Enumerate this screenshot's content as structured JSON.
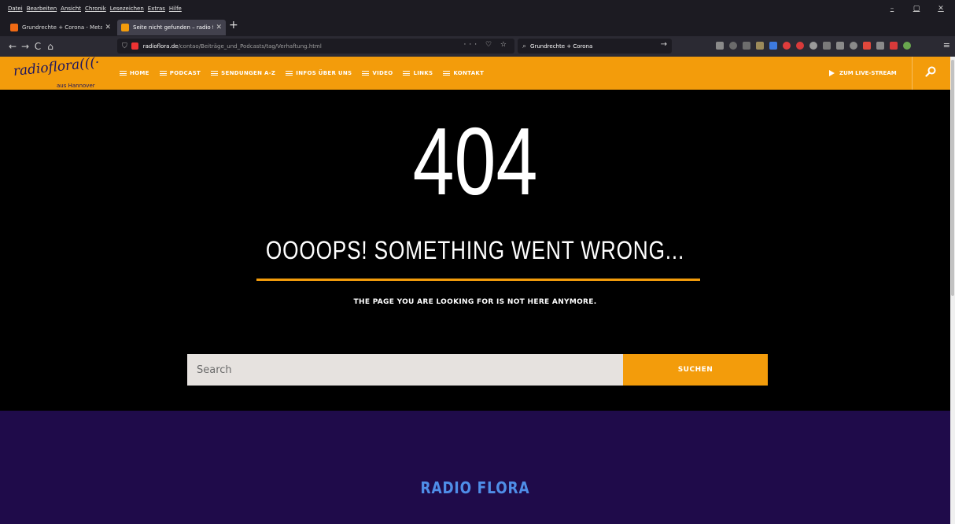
{
  "browser": {
    "menu": [
      "Datei",
      "Bearbeiten",
      "Ansicht",
      "Chronik",
      "Lesezeichen",
      "Extras",
      "Hilfe"
    ],
    "window_controls": [
      "–",
      "▢",
      "✕"
    ],
    "tabs": [
      {
        "title": "Grundrechte + Corona - MetaGer",
        "close": "✕"
      },
      {
        "title": "Seite nicht gefunden – radio flora",
        "close": "✕"
      }
    ],
    "new_tab": "+",
    "nav": {
      "back": "←",
      "forward": "→",
      "reload": "C",
      "home": "⌂"
    },
    "url_host": "radioflora.de",
    "url_path": "/contao/Beiträge_und_Podcasts/tag/Verhaftung.html",
    "url_actions": "··· ♡ ☆",
    "search_query": "Grundrechte + Corona",
    "menu_icon": "≡"
  },
  "site": {
    "logo_text": "radioflora(((·",
    "logo_sub": "aus Hannover",
    "nav": [
      "HOME",
      "PODCAST",
      "SENDUNGEN A-Z",
      "INFOS ÜBER UNS",
      "VIDEO",
      "LINKS",
      "KONTAKT"
    ],
    "livestream": "ZUM LIVE-STREAM"
  },
  "error": {
    "code": "404",
    "title": "OOOOPS! SOMETHING WENT WRONG...",
    "message": "THE PAGE YOU ARE LOOKING FOR IS NOT HERE ANYMORE.",
    "search_placeholder": "Search",
    "search_button": "SUCHEN"
  },
  "footer": {
    "title": "RADIO FLORA"
  },
  "colors": {
    "accent": "#f39c0b",
    "footer_bg": "#1f0b4a",
    "footer_title": "#4f8ee8"
  }
}
